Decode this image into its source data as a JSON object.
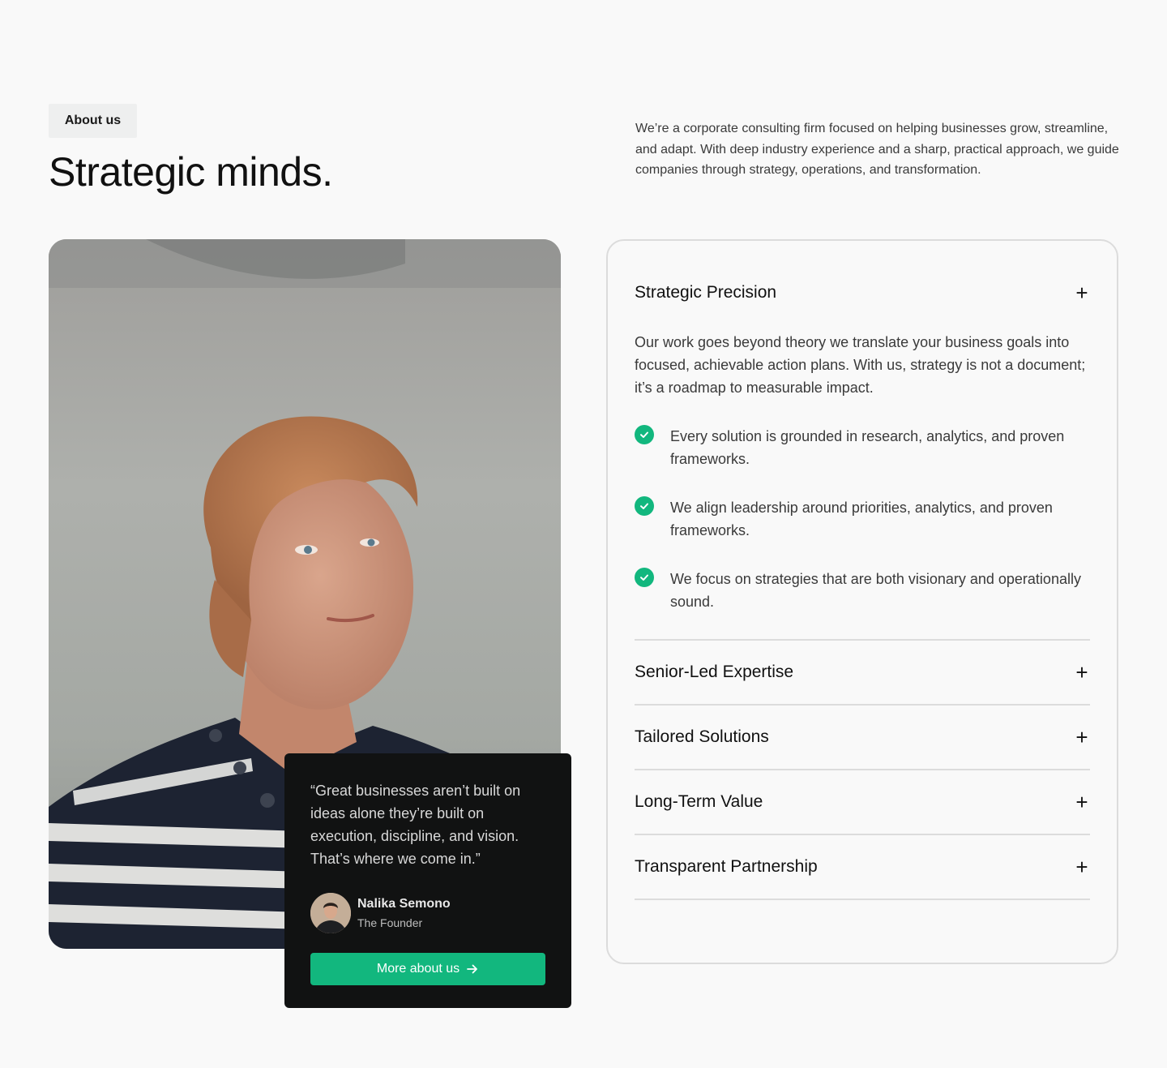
{
  "header": {
    "eyebrow": "About us",
    "title": "Strategic minds.",
    "intro": "We’re a corporate consulting firm focused on helping businesses grow, streamline, and adapt. With deep industry experience and a sharp, practical approach, we guide companies through strategy, operations, and transformation."
  },
  "quote_card": {
    "quote": "“Great businesses aren’t built on ideas alone they’re built on execution, discipline, and vision. That’s where we come in.”",
    "author_name": "Nalika Semono",
    "author_role": "The Founder",
    "cta_label": "More about us",
    "cta_icon": "arrow-right-icon"
  },
  "accordion": {
    "plus_symbol": "+",
    "open_item": {
      "title": "Strategic Precision",
      "body_line1": "Our work goes beyond theory we translate your business goals into focused, achievable action plans. With us, strategy is not a document;",
      "body_line2": "it’s a roadmap to measurable impact.",
      "points": [
        "Every solution is grounded in research, analytics, and proven frameworks.",
        "We align leadership around priorities, analytics, and proven frameworks.",
        "We focus on strategies that are both visionary and operationally sound."
      ]
    },
    "items": [
      {
        "title": "Senior-Led Expertise"
      },
      {
        "title": "Tailored Solutions"
      },
      {
        "title": "Long-Term Value"
      },
      {
        "title": "Transparent Partnership"
      }
    ]
  },
  "colors": {
    "accent": "#12b77e",
    "card_dark": "#111212",
    "background": "#f9f9f9",
    "border": "#dcdcdc"
  }
}
